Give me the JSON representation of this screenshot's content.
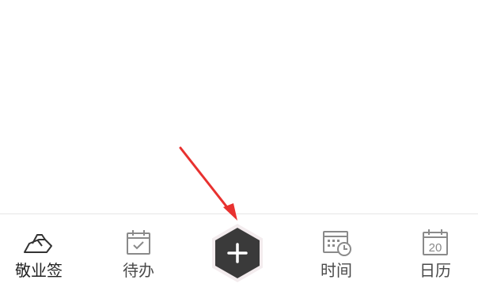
{
  "tabbar": {
    "items": [
      {
        "label": "敬业签",
        "icon": "notebook-logo-icon",
        "active": true
      },
      {
        "label": "待办",
        "icon": "calendar-check-icon",
        "active": false
      },
      {
        "label": "",
        "icon": "plus-icon",
        "active": false
      },
      {
        "label": "时间",
        "icon": "calendar-clock-icon",
        "active": false
      },
      {
        "label": "日历",
        "icon": "calendar-date-icon",
        "active": false,
        "date_number": "20"
      }
    ]
  },
  "colors": {
    "add_button": "#3a3a3a",
    "add_button_halo": "#f3ecee",
    "icon_gray": "#8a8a8a",
    "arrow": "#e8312f"
  }
}
